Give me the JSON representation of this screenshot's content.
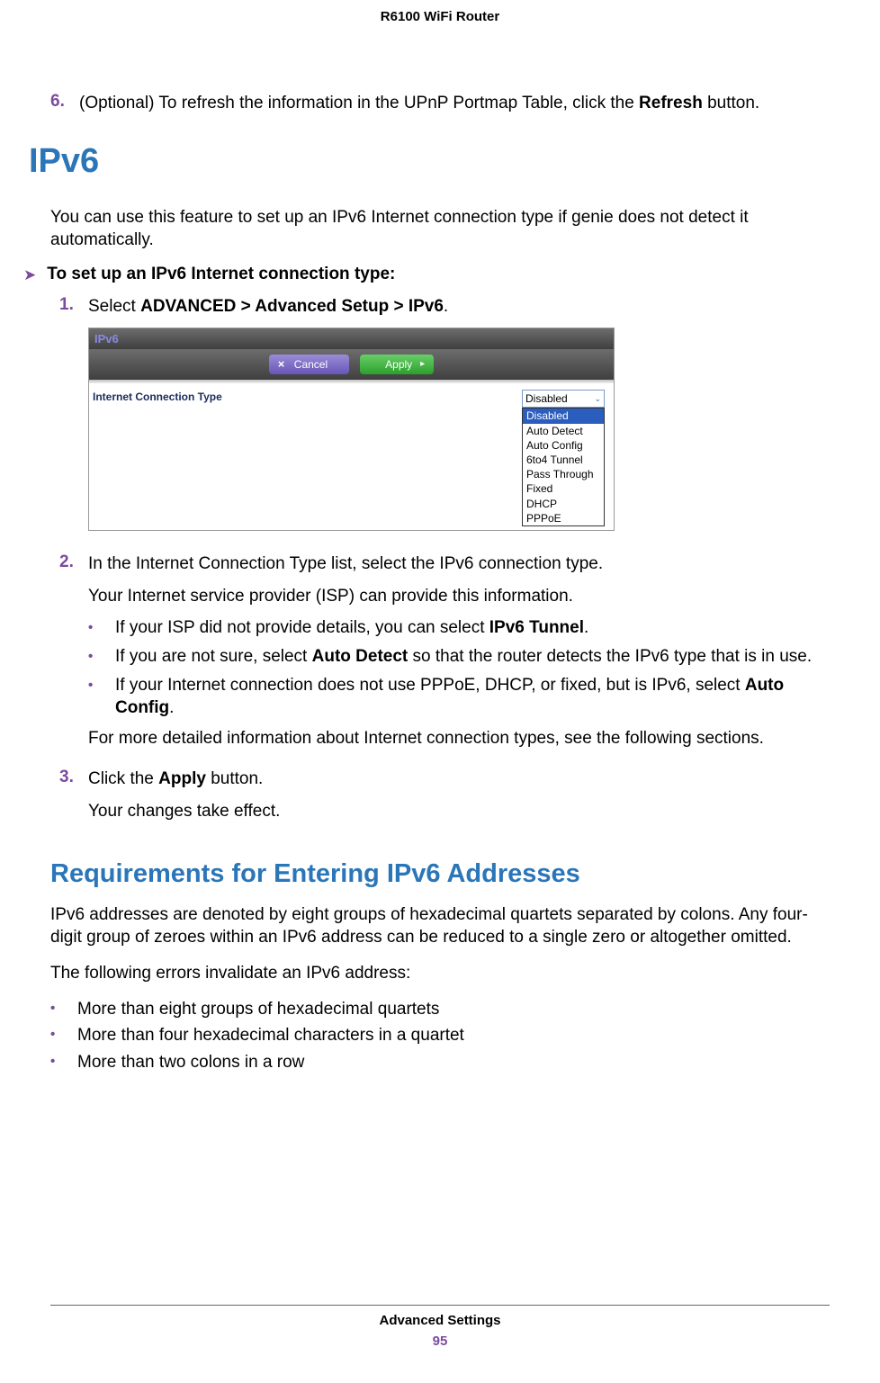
{
  "page_header": "R6100 WiFi Router",
  "step6": {
    "num": "6.",
    "text_before": "(Optional) To refresh the information in the UPnP Portmap Table, click the ",
    "bold": "Refresh",
    "text_after": " button."
  },
  "h2": "IPv6",
  "intro": "You can use this feature to set up an IPv6 Internet connection type if genie does not detect it automatically.",
  "task_heading": "To set up an IPv6 Internet connection type:",
  "steps": {
    "s1": {
      "num": "1.",
      "text_before": "Select ",
      "bold": "ADVANCED > Advanced Setup > IPv6",
      "text_after": "."
    },
    "screenshot": {
      "title": "IPv6",
      "cancel": "Cancel",
      "apply": "Apply",
      "label": "Internet Connection Type",
      "selected": "Disabled",
      "options": [
        "Disabled",
        "Auto Detect",
        "Auto Config",
        "6to4 Tunnel",
        "Pass Through",
        "Fixed",
        "DHCP",
        "PPPoE"
      ]
    },
    "s2": {
      "num": "2.",
      "p1": "In the Internet Connection Type list, select the IPv6 connection type.",
      "p2": "Your Internet service provider (ISP) can provide this information.",
      "b1_before": "If your ISP did not provide details, you can select ",
      "b1_bold": "IPv6 Tunnel",
      "b1_after": ".",
      "b2_before": "If you are not sure, select ",
      "b2_bold": "Auto Detect",
      "b2_after": " so that the router detects the IPv6 type that is in use.",
      "b3_before": "If your Internet connection does not use PPPoE, DHCP, or fixed, but is IPv6, select ",
      "b3_bold": "Auto Config",
      "b3_after": ".",
      "p3": "For more detailed information about Internet connection types, see the following sections."
    },
    "s3": {
      "num": "3.",
      "p1_before": "Click the ",
      "p1_bold": "Apply",
      "p1_after": " button.",
      "p2": "Your changes take effect."
    }
  },
  "h3": "Requirements for Entering IPv6 Addresses",
  "req_p1": "IPv6 addresses are denoted by eight groups of hexadecimal quartets separated by colons. Any four-digit group of zeroes within an IPv6 address can be reduced to a single zero or altogether omitted.",
  "req_p2": "The following errors invalidate an IPv6 address:",
  "errors": [
    "More than eight groups of hexadecimal quartets",
    "More than four hexadecimal characters in a quartet",
    "More than two colons in a row"
  ],
  "footer": {
    "title": "Advanced Settings",
    "page": "95"
  }
}
